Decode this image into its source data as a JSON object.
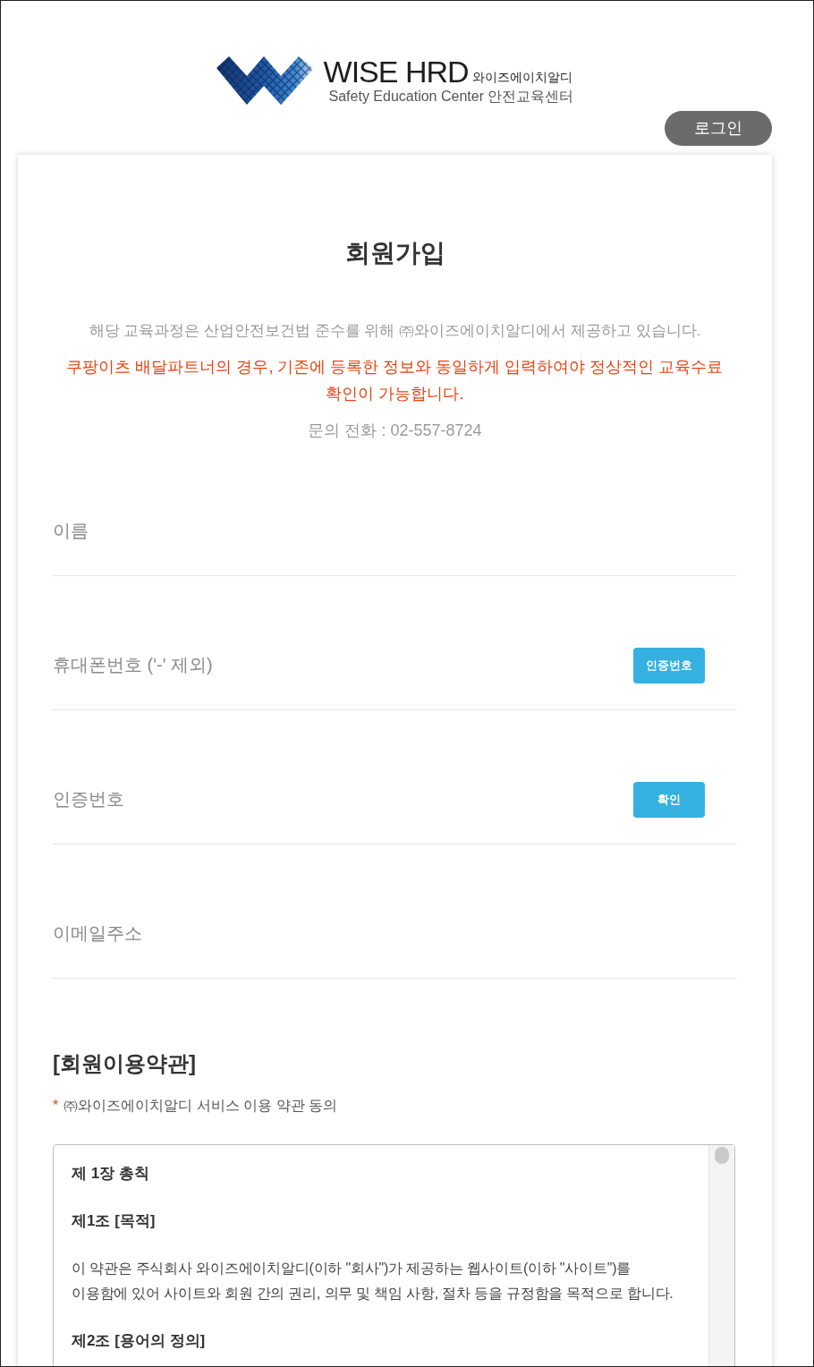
{
  "header": {
    "brand": {
      "name": "WISE HRD",
      "name_ko": "와이즈에이치알디",
      "tagline": "Safety Education Center 안전교육센터"
    },
    "login_button": "로그인"
  },
  "form": {
    "title": "회원가입",
    "notice": "해당 교육과정은 산업안전보건법 준수를 위해 ㈜와이즈에이치알디에서 제공하고 있습니다.",
    "warning": "쿠팡이츠 배달파트너의 경우, 기존에 등록한 정보와 동일하게 입력하여야 정상적인 교육수료 확인이 가능합니다.",
    "contact": "문의 전화 : 02-557-8724",
    "fields": [
      {
        "placeholder": "이름"
      },
      {
        "placeholder": "휴대폰번호 ('-' 제외)",
        "button": "인증번호"
      },
      {
        "placeholder": "인증번호",
        "button": "확인"
      },
      {
        "placeholder": "이메일주소"
      }
    ],
    "terms": {
      "title": "[회원이용약관]",
      "required_mark": "*",
      "agreement_label": "㈜와이즈에이치알디 서비스 이용 약관 동의",
      "content": [
        {
          "kind": "heading",
          "text": "제 1장 총칙"
        },
        {
          "kind": "heading",
          "text": "제1조 [목적]"
        },
        {
          "kind": "paragraph",
          "lines": [
            "이 약관은 주식회사 와이즈에이치알디(이하 \"회사\")가 제공하는 웹사이트(이하 \"사이트\")를",
            "이용함에 있어 사이트와 회원 간의 권리, 의무 및 책임 사항, 절차 등을 규정함을 목적으로 합니다."
          ]
        },
        {
          "kind": "heading",
          "text": "제2조 [용어의 정의]"
        }
      ]
    }
  }
}
